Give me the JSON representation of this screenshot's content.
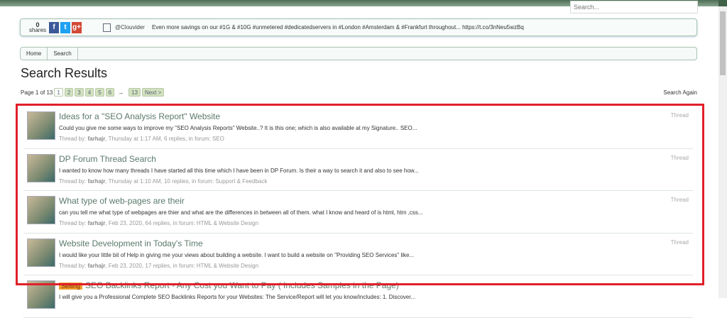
{
  "header": {
    "search_placeholder": "Search..."
  },
  "share": {
    "count": "0",
    "count_label": "shares",
    "facebook": "f",
    "twitter": "t",
    "google": "g+",
    "handle": "@Clouvider",
    "tweet": "Even more savings on our #1G & #10G #unmetered #dedicatedservers in #London #Amsterdam & #Frankfurt throughout... https://t.co/3nNeu5wzBq"
  },
  "breadcrumb": [
    "Home",
    "Search"
  ],
  "page_title": "Search Results",
  "pagination": {
    "label": "Page 1 of 13",
    "pages": [
      "1",
      "2",
      "3",
      "4",
      "5",
      "6"
    ],
    "ellipsis": "→",
    "last": "13",
    "next": "Next >"
  },
  "search_again": "Search Again",
  "results": [
    {
      "title": "Ideas for a \"SEO Analysis Report\" Website",
      "snippet": "Could you give me some ways to improve my \"SEO Analysis Reports\" Website..? It is this one; which is also available at my Signature.. SEO...",
      "prefix": "Thread by: ",
      "author": "farhajr",
      "meta": ", Thursday at 1:17 AM, 6 replies, in forum: SEO",
      "type": "Thread"
    },
    {
      "title": "DP Forum Thread Search",
      "snippet": "I wanted to know how many threads I have started all this time which I have been in DP Forum. Is their a way to search it and also to see how...",
      "prefix": "Thread by: ",
      "author": "farhajr",
      "meta": ", Thursday at 1:10 AM, 10 replies, in forum: Support & Feedback",
      "type": "Thread"
    },
    {
      "title": "What type of web-pages are their",
      "snippet": "can you tell me what type of webpages are thier and what are the differences in between all of them. what I know and heard of is html, htm ,css...",
      "prefix": "Thread by: ",
      "author": "farhajr",
      "meta": ", Feb 23, 2020, 64 replies, in forum: HTML & Website Design",
      "type": "Thread"
    },
    {
      "title": "Website Development in Today's Time",
      "snippet": "I would like your little bit of Help in giving me your views about building a website. I want to build a website on \"Providing SEO Services\" like...",
      "prefix": "Thread by: ",
      "author": "farhajr",
      "meta": ", Feb 23, 2020, 17 replies, in forum: HTML & Website Design",
      "type": "Thread"
    },
    {
      "badge": "Selling",
      "title": "SEO Backlinks Report - Any Cost you Want to Pay ( Includes Samples in the Page)",
      "snippet": "I will give you a Professional Complete SEO Backlinks Reports for your Websites: The Service/Report will let you know/includes: 1. Discover..."
    }
  ]
}
